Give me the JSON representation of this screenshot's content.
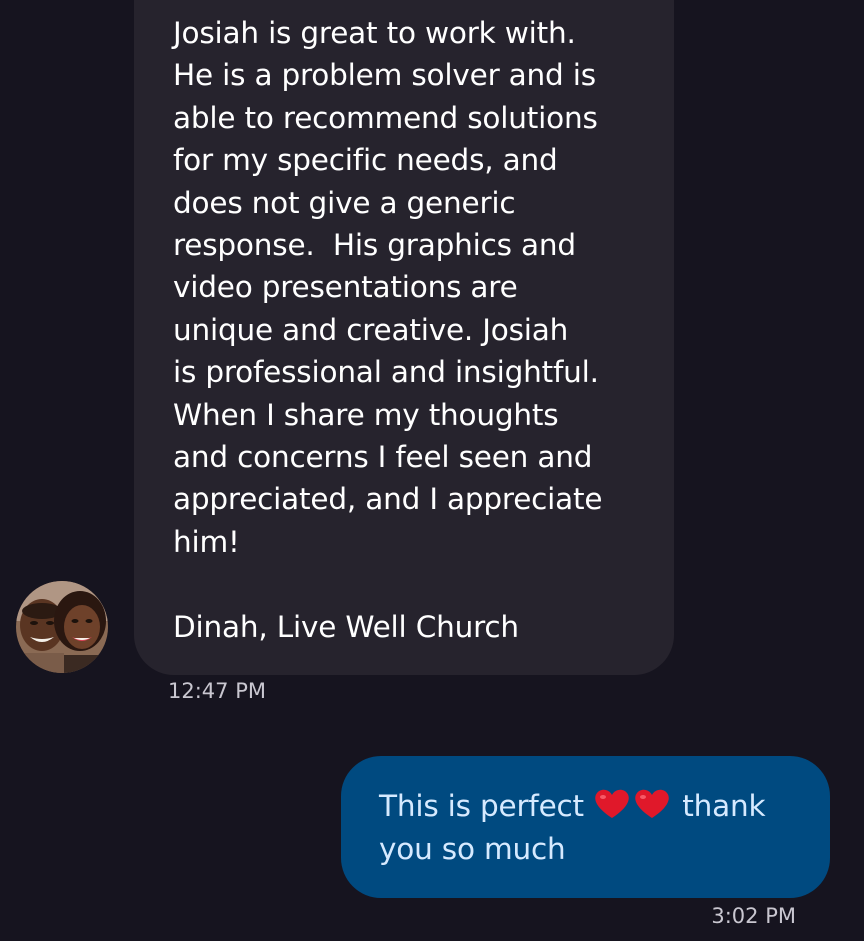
{
  "conversation": {
    "incoming": {
      "text": "Josiah is great to work with.\nHe is a problem solver and is\nable to recommend solutions\nfor my specific needs, and\ndoes not give a generic\nresponse.  His graphics and\nvideo presentations are\nunique and creative. Josiah\nis professional and insightful.\nWhen I share my thoughts\nand concerns I feel seen and\nappreciated, and I appreciate\nhim!\n\nDinah, Live Well Church",
      "time": "12:47 PM",
      "avatar_icon": "contact-photo",
      "bubble_color": "#26232d"
    },
    "outgoing": {
      "text_before": "This is perfect ",
      "emojis": [
        "red-heart-icon",
        "red-heart-icon"
      ],
      "text_after": " thank\nyou so much",
      "time": "3:02 PM",
      "bubble_color": "#004a80"
    }
  },
  "colors": {
    "background": "#16141f",
    "incoming_text": "#ffffff",
    "outgoing_text": "#d6eaff",
    "timestamp": "#c9c7d0"
  }
}
